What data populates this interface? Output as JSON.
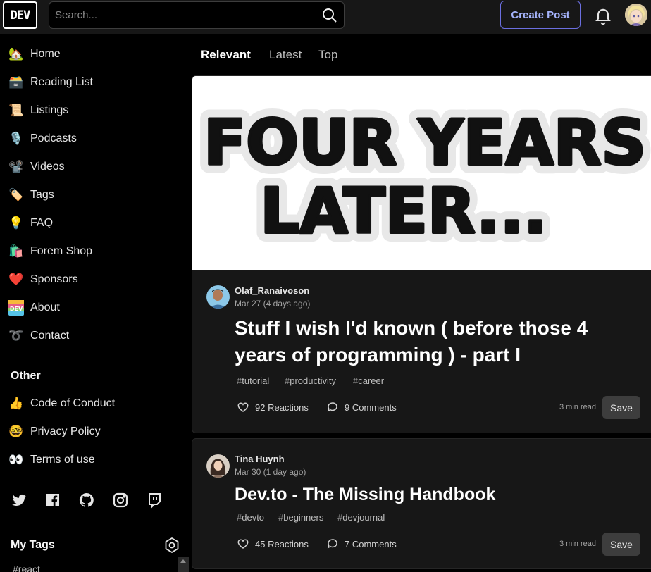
{
  "header": {
    "logo": "DEV",
    "search_placeholder": "Search...",
    "create_post": "Create Post"
  },
  "sidebar": {
    "nav": [
      {
        "label": "Home",
        "icon": "house-icon",
        "emoji": "🏡"
      },
      {
        "label": "Reading List",
        "icon": "card-box-icon",
        "emoji": "🗃️"
      },
      {
        "label": "Listings",
        "icon": "scroll-icon",
        "emoji": "📜"
      },
      {
        "label": "Podcasts",
        "icon": "microphone-icon",
        "emoji": "🎙️"
      },
      {
        "label": "Videos",
        "icon": "video-camera-icon",
        "emoji": "📽️"
      },
      {
        "label": "Tags",
        "icon": "tag-icon",
        "emoji": "🏷️"
      },
      {
        "label": "FAQ",
        "icon": "lightbulb-icon",
        "emoji": "💡"
      },
      {
        "label": "Forem Shop",
        "icon": "shopping-bags-icon",
        "emoji": "🛍️"
      },
      {
        "label": "Sponsors",
        "icon": "heart-icon",
        "emoji": "❤️"
      },
      {
        "label": "About",
        "icon": "dev-badge-icon",
        "emoji": ""
      },
      {
        "label": "Contact",
        "icon": "phone-icon",
        "emoji": "➰"
      }
    ],
    "other_title": "Other",
    "other": [
      {
        "label": "Code of Conduct",
        "icon": "thumbs-up-icon",
        "emoji": "👍"
      },
      {
        "label": "Privacy Policy",
        "icon": "nerd-face-icon",
        "emoji": "🤓"
      },
      {
        "label": "Terms of use",
        "icon": "eyes-icon",
        "emoji": "👀"
      }
    ],
    "social_icons": [
      "twitter-icon",
      "facebook-icon",
      "github-icon",
      "instagram-icon",
      "twitch-icon"
    ],
    "my_tags_title": "My Tags",
    "partial_tag": "#react"
  },
  "feed": {
    "tabs": [
      "Relevant",
      "Latest",
      "Top"
    ],
    "active_tab": "Relevant"
  },
  "posts": [
    {
      "cover_line1": "FOUR YEARS",
      "cover_line2": "LATER...",
      "author": "Olaf_Ranaivoson",
      "date": "Mar 27 (4 days ago)",
      "title_line1": "Stuff I wish I'd known ( before those 4",
      "title_line2": "years of programming ) - part I",
      "tags": [
        "tutorial",
        "productivity",
        "career"
      ],
      "reactions": "92 Reactions",
      "comments": "9 Comments",
      "read_time": "3 min read",
      "save": "Save"
    },
    {
      "author": "Tina Huynh",
      "date": "Mar 30 (1 day ago)",
      "title": "Dev.to - The Missing Handbook",
      "tags": [
        "devto",
        "beginners",
        "devjournal"
      ],
      "reactions": "45 Reactions",
      "comments": "7 Comments",
      "read_time": "3 min read",
      "save": "Save"
    }
  ],
  "colors": {
    "background": "#000000",
    "header": "#171717",
    "card": "#171717",
    "accent": "#6b6fe0"
  }
}
